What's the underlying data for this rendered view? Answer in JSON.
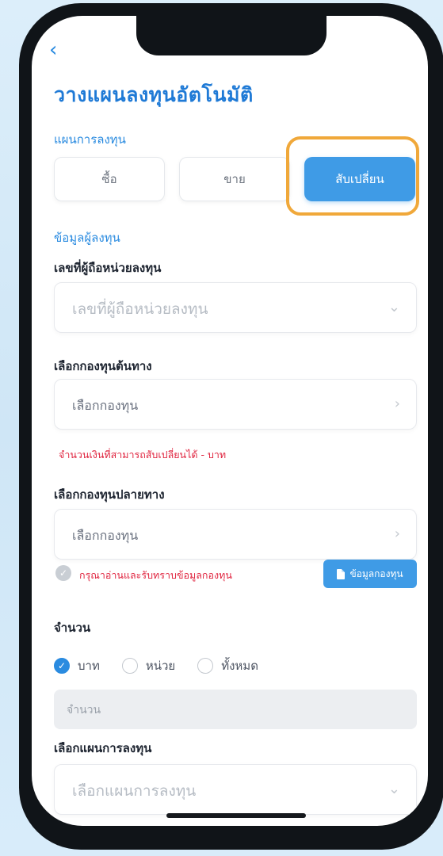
{
  "header": {
    "back_icon": "chevron-left-icon",
    "title": "วางแผนลงทุนอัตโนมัติ"
  },
  "plan_section": {
    "label": "แผนการลงทุน",
    "options": [
      {
        "label": "ซื้อ",
        "selected": false
      },
      {
        "label": "ขาย",
        "selected": false
      },
      {
        "label": "สับเปลี่ยน",
        "selected": true
      }
    ]
  },
  "investor_section": {
    "label": "ข้อมูลผู้ลงทุน",
    "holder_number": {
      "label": "เลขที่ผู้ถือหน่วยลงทุน",
      "placeholder": "เลขที่ผู้ถือหน่วยลงทุน"
    },
    "source_fund": {
      "label": "เลือกกองทุนต้นทาง",
      "value": "เลือกกองทุน",
      "warning": "จำนวนเงินที่สามารถสับเปลี่ยนได้ - บาท"
    },
    "destination_fund": {
      "label": "เลือกกองทุนปลายทาง",
      "value": "เลือกกองทุน"
    },
    "acknowledge": {
      "text": "กรุณาอ่านและรับทราบข้อมูลกองทุน",
      "button_label": "ข้อมูลกองทุน"
    },
    "amount": {
      "label": "จำนวน",
      "units": [
        {
          "label": "บาท",
          "checked": true
        },
        {
          "label": "หน่วย",
          "checked": false
        },
        {
          "label": "ทั้งหมด",
          "checked": false
        }
      ],
      "placeholder": "จำนวน"
    },
    "invest_plan": {
      "label": "เลือกแผนการลงทุน",
      "placeholder": "เลือกแผนการลงทุน"
    }
  },
  "colors": {
    "accent": "#2a8be0",
    "warning": "#e0243f",
    "highlight": "#f0a83a"
  }
}
